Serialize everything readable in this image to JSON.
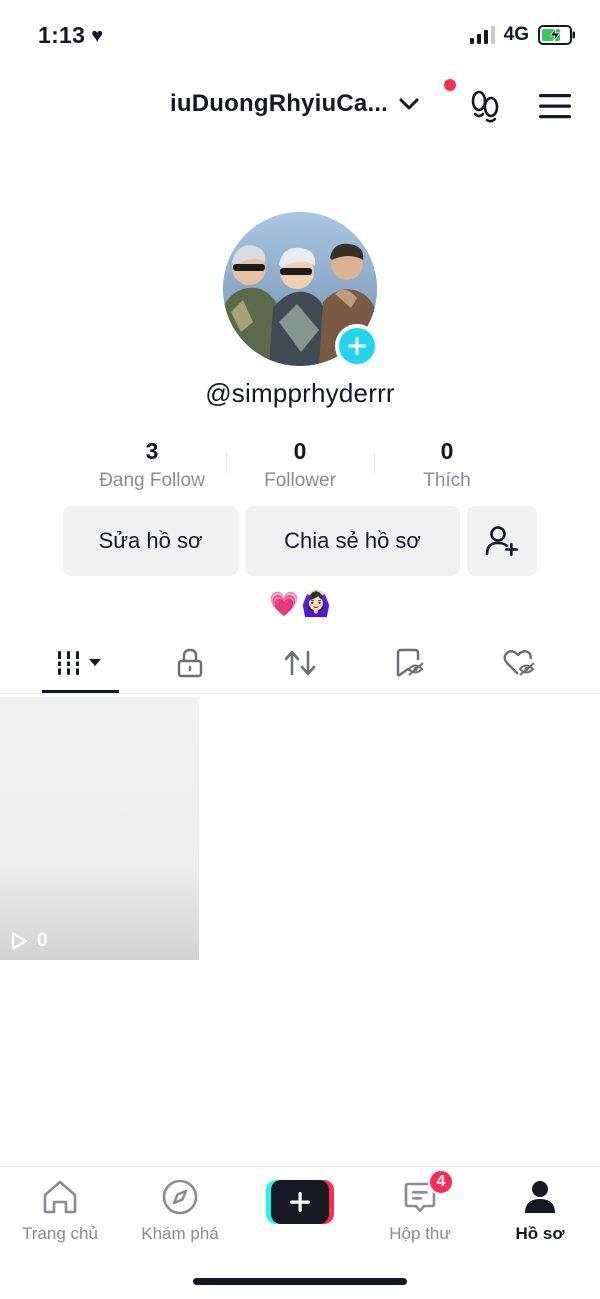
{
  "status_bar": {
    "time": "1:13",
    "heart": "♥",
    "network": "4G"
  },
  "header": {
    "account_name": "iuDuongRhyiuCa...",
    "has_notification": true
  },
  "profile": {
    "handle": "@simpprhyderrr",
    "stats": [
      {
        "value": "3",
        "label": "Đang Follow"
      },
      {
        "value": "0",
        "label": "Follower"
      },
      {
        "value": "0",
        "label": "Thích"
      }
    ],
    "buttons": {
      "edit": "Sửa hồ sơ",
      "share": "Chia sẻ hồ sơ"
    },
    "bio": [
      "💗",
      "🙆🏻‍♀️"
    ]
  },
  "tabs": [
    {
      "icon": "grid-icon",
      "active": true
    },
    {
      "icon": "lock-icon",
      "active": false
    },
    {
      "icon": "repost-icon",
      "active": false
    },
    {
      "icon": "hidden-bookmark-icon",
      "active": false
    },
    {
      "icon": "hidden-likes-icon",
      "active": false
    }
  ],
  "videos": [
    {
      "views": "0"
    }
  ],
  "bottom_nav": {
    "home": "Trang chủ",
    "explore": "Khám phá",
    "inbox": "Hộp thư",
    "inbox_badge": "4",
    "profile": "Hồ sơ"
  },
  "colors": {
    "accent_pink": "#fe2c55",
    "accent_cyan": "#25f4ee",
    "avatar_add": "#20d5ec",
    "text": "#161823",
    "muted": "#8a8b91"
  }
}
